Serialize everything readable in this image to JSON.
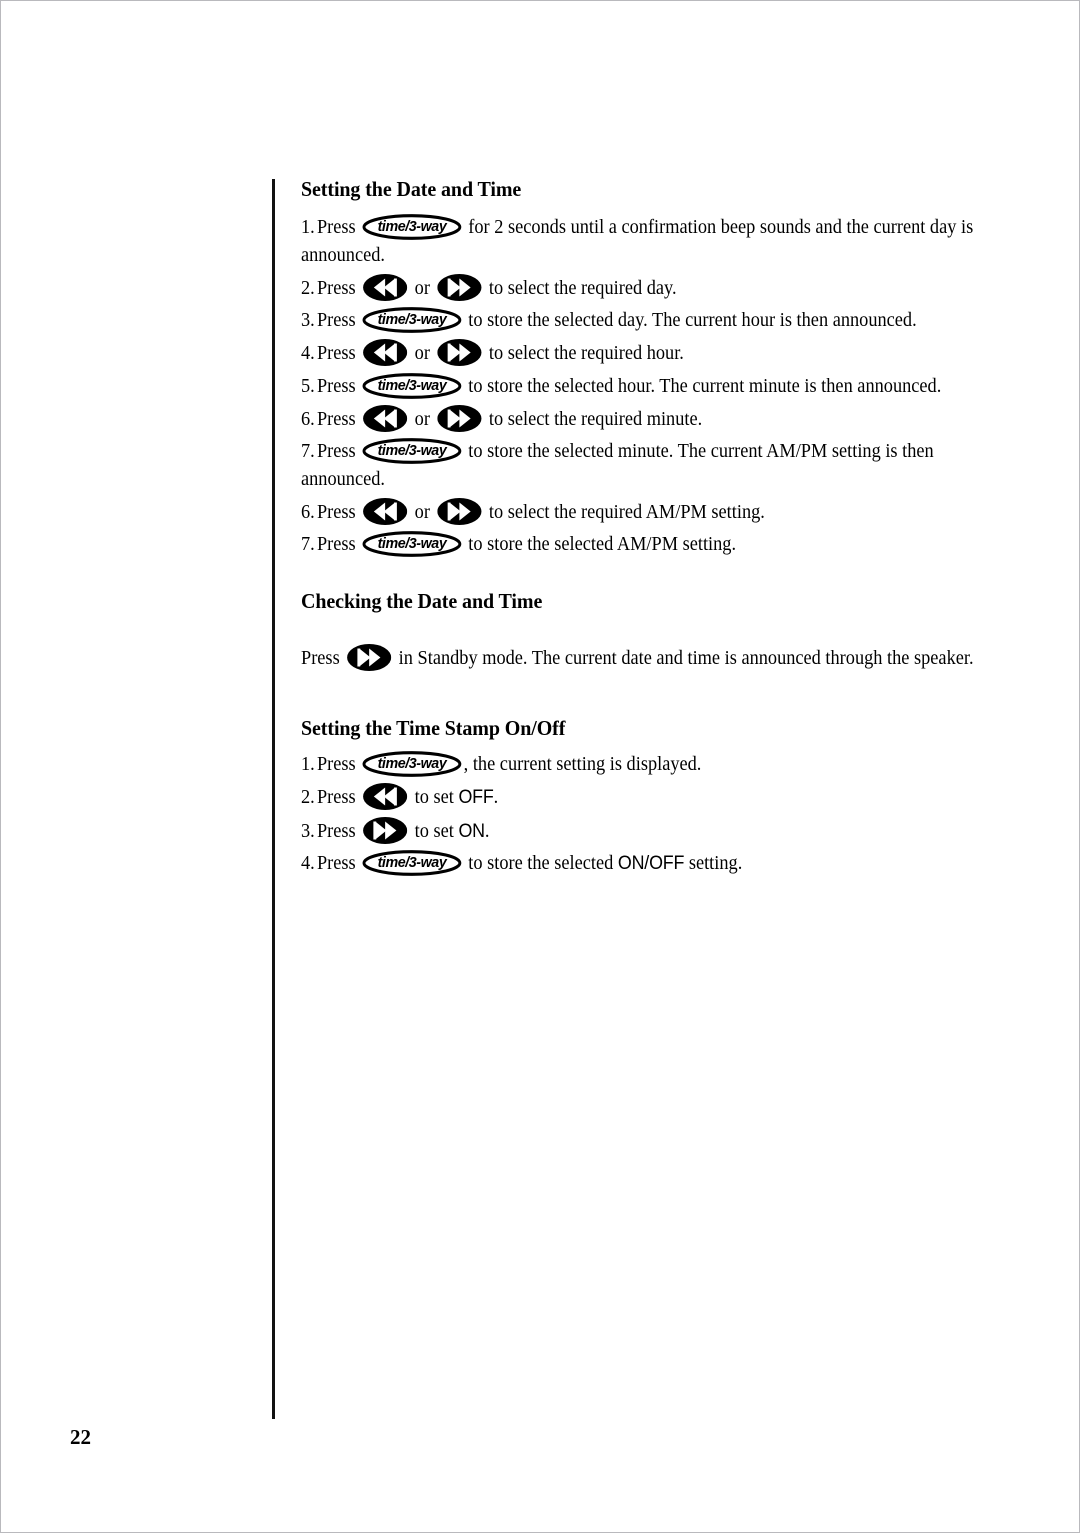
{
  "page": {
    "number": "22"
  },
  "icons": {
    "time_button_label": "time/3-way",
    "rewind_icon_name": "rewind-double-left-arrow-icon",
    "forward_icon_name": "fast-forward-double-right-arrow-icon"
  },
  "sections": [
    {
      "id": "setting-the-date-and-time",
      "heading": "Setting the Date and Time",
      "steps": [
        {
          "num": "1.",
          "pre": "Press",
          "button": "time",
          "post": "for 2 seconds until a confirmation beep sounds and the current day is announced."
        },
        {
          "num": "2.",
          "pre": "Press",
          "button": "rewind-or-forward",
          "mid": "or",
          "post": "to select the required day."
        },
        {
          "num": "3.",
          "pre": "Press",
          "button": "time",
          "post": "to store the selected day. The current hour is then announced."
        },
        {
          "num": "4.",
          "pre": "Press",
          "button": "rewind-or-forward",
          "mid": "or",
          "post": "to select the required hour."
        },
        {
          "num": "5.",
          "pre": "Press",
          "button": "time",
          "post": "to store the selected hour. The current minute is then announced."
        },
        {
          "num": "6.",
          "pre": "Press",
          "button": "rewind-or-forward",
          "mid": "or",
          "post": "to select the required minute."
        },
        {
          "num": "7.",
          "pre": "Press",
          "button": "time",
          "post": "to store the selected minute. The current AM/PM setting is then announced."
        },
        {
          "num": "6.",
          "pre": "Press",
          "button": "rewind-or-forward",
          "mid": "or",
          "post": "to select the required AM/PM setting."
        },
        {
          "num": "7.",
          "pre": "Press",
          "button": "time",
          "post": "to store the selected AM/PM setting."
        }
      ]
    },
    {
      "id": "checking-the-date-and-time",
      "heading": "Checking the Date and Time",
      "paragraph": {
        "pre": "Press",
        "button": "forward",
        "post": "in Standby mode. The current date and time is announced through the speaker."
      }
    },
    {
      "id": "setting-the-time-stamp-on-off",
      "heading": "Setting the Time Stamp On/Off",
      "steps": [
        {
          "num": "1.",
          "pre": "Press",
          "button": "time",
          "post": ", the current setting is displayed."
        },
        {
          "num": "2.",
          "pre": "Press",
          "button": "rewind",
          "post_a": "to set ",
          "post_emph": "OFF",
          "post_b": "."
        },
        {
          "num": "3.",
          "pre": "Press",
          "button": "forward",
          "post_a": "to set ",
          "post_emph": "ON",
          "post_b": "."
        },
        {
          "num": "4.",
          "pre": "Press",
          "button": "time",
          "post_a": "to store the selected ",
          "post_emph": "ON/OFF",
          "post_b": " setting."
        }
      ]
    }
  ]
}
